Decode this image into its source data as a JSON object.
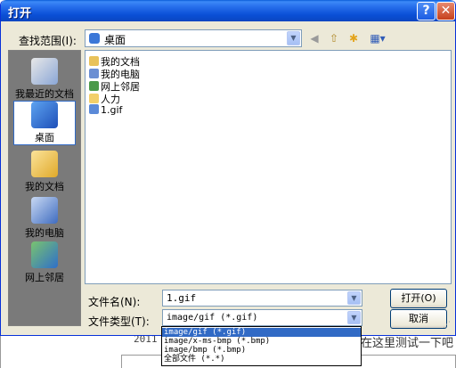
{
  "window": {
    "title": "打开"
  },
  "title_buttons": {
    "help": "?",
    "close": "✕"
  },
  "lookin": {
    "label": "查找范围(I):",
    "value": "桌面"
  },
  "toolbar": [
    {
      "name": "back-icon",
      "glyph": "◀"
    },
    {
      "name": "up-folder-icon",
      "glyph": "⇧"
    },
    {
      "name": "new-folder-icon",
      "glyph": "✱"
    },
    {
      "name": "view-menu-icon",
      "glyph": "▦▾"
    }
  ],
  "places": [
    {
      "label": "我最近的文档",
      "icon": "recent-documents-icon"
    },
    {
      "label": "桌面",
      "icon": "desktop-icon",
      "selected": true
    },
    {
      "label": "我的文档",
      "icon": "my-documents-icon"
    },
    {
      "label": "我的电脑",
      "icon": "my-computer-icon"
    },
    {
      "label": "网上邻居",
      "icon": "network-places-icon"
    }
  ],
  "files": [
    {
      "name": "我的文档",
      "icon": "folder-documents-icon",
      "color": "#e8c25a"
    },
    {
      "name": "我的电脑",
      "icon": "computer-icon",
      "color": "#6b8fd3"
    },
    {
      "name": "网上邻居",
      "icon": "network-icon",
      "color": "#4b9a4a"
    },
    {
      "name": "人力",
      "icon": "folder-icon",
      "color": "#f2cf6a"
    },
    {
      "name": "1.gif",
      "icon": "gif-file-icon",
      "color": "#5b8ad8"
    }
  ],
  "filename": {
    "label": "文件名(N):",
    "value": "1.gif"
  },
  "filetype": {
    "label": "文件类型(T):",
    "value": "image/gif (*.gif)"
  },
  "buttons": {
    "open": "打开(O)",
    "cancel": "取消"
  },
  "filetype_options": [
    "image/gif (*.gif)",
    "image/x-ms-bmp (*.bmp)",
    "image/bmp (*.bmp)",
    "全部文件 (*.*)"
  ],
  "background": {
    "left_text": "2011",
    "right_text": "在这里测试一下吧"
  }
}
